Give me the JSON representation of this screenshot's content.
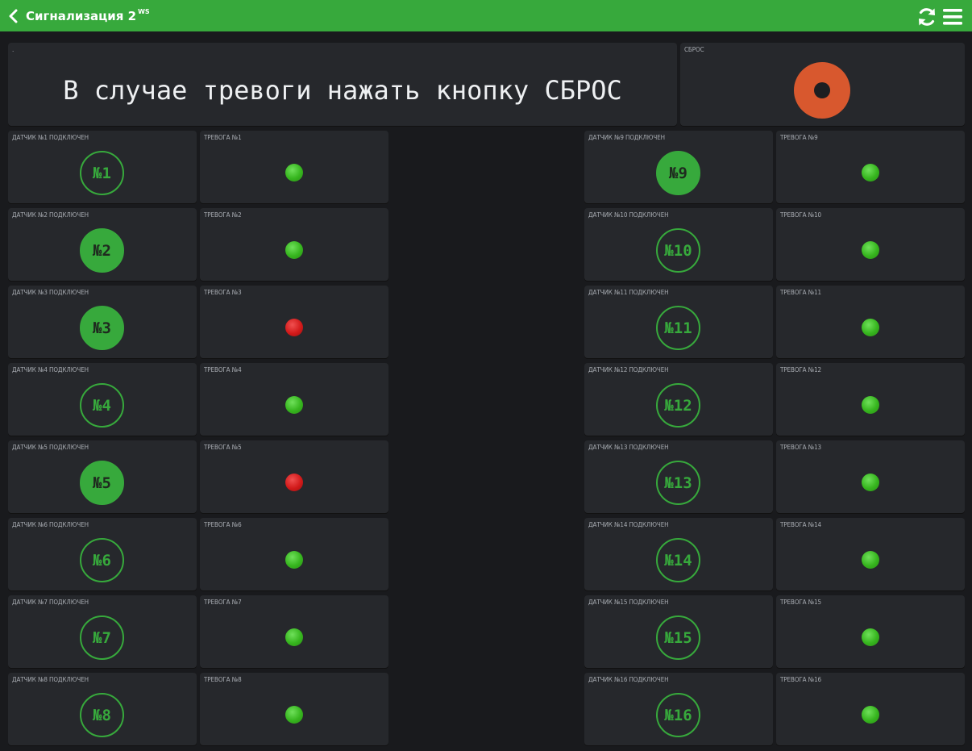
{
  "header": {
    "title": "Сигнализация 2",
    "superscript": "WS",
    "back_icon": "chevron-left-icon",
    "refresh_icon": "refresh-icon",
    "menu_icon": "menu-icon",
    "color": "#37a93c"
  },
  "message_tile": {
    "label": ".",
    "text": "В случае тревоги нажать кнопку СБРОС"
  },
  "reset_tile": {
    "label": "СБРОС",
    "color": "#d8582e"
  },
  "sensors": [
    {
      "label": "ДАТЧИК №1 ПОДКЛЮЧЕН",
      "number": "№1",
      "connected": false,
      "alarm_label": "ТРЕВОГА №1",
      "alarm": false
    },
    {
      "label": "ДАТЧИК №2 ПОДКЛЮЧЕН",
      "number": "№2",
      "connected": true,
      "alarm_label": "ТРЕВОГА №2",
      "alarm": false
    },
    {
      "label": "ДАТЧИК №3 ПОДКЛЮЧЕН",
      "number": "№3",
      "connected": true,
      "alarm_label": "ТРЕВОГА №3",
      "alarm": true
    },
    {
      "label": "ДАТЧИК №4 ПОДКЛЮЧЕН",
      "number": "№4",
      "connected": false,
      "alarm_label": "ТРЕВОГА №4",
      "alarm": false
    },
    {
      "label": "ДАТЧИК №5 ПОДКЛЮЧЕН",
      "number": "№5",
      "connected": true,
      "alarm_label": "ТРЕВОГА №5",
      "alarm": true
    },
    {
      "label": "ДАТЧИК №6 ПОДКЛЮЧЕН",
      "number": "№6",
      "connected": false,
      "alarm_label": "ТРЕВОГА №6",
      "alarm": false
    },
    {
      "label": "ДАТЧИК №7 ПОДКЛЮЧЕН",
      "number": "№7",
      "connected": false,
      "alarm_label": "ТРЕВОГА №7",
      "alarm": false
    },
    {
      "label": "ДАТЧИК №8 ПОДКЛЮЧЕН",
      "number": "№8",
      "connected": false,
      "alarm_label": "ТРЕВОГА №8",
      "alarm": false
    },
    {
      "label": "ДАТЧИК №9 ПОДКЛЮЧЕН",
      "number": "№9",
      "connected": true,
      "alarm_label": "ТРЕВОГА №9",
      "alarm": false
    },
    {
      "label": "ДАТЧИК №10 ПОДКЛЮЧЕН",
      "number": "№10",
      "connected": false,
      "alarm_label": "ТРЕВОГА №10",
      "alarm": false
    },
    {
      "label": "ДАТЧИК №11 ПОДКЛЮЧЕН",
      "number": "№11",
      "connected": false,
      "alarm_label": "ТРЕВОГА №11",
      "alarm": false
    },
    {
      "label": "ДАТЧИК №12 ПОДКЛЮЧЕН",
      "number": "№12",
      "connected": false,
      "alarm_label": "ТРЕВОГА №12",
      "alarm": false
    },
    {
      "label": "ДАТЧИК №13 ПОДКЛЮЧЕН",
      "number": "№13",
      "connected": false,
      "alarm_label": "ТРЕВОГА №13",
      "alarm": false
    },
    {
      "label": "ДАТЧИК №14 ПОДКЛЮЧЕН",
      "number": "№14",
      "connected": false,
      "alarm_label": "ТРЕВОГА №14",
      "alarm": false
    },
    {
      "label": "ДАТЧИК №15 ПОДКЛЮЧЕН",
      "number": "№15",
      "connected": false,
      "alarm_label": "ТРЕВОГА №15",
      "alarm": false
    },
    {
      "label": "ДАТЧИК №16 ПОДКЛЮЧЕН",
      "number": "№16",
      "connected": false,
      "alarm_label": "ТРЕВОГА №16",
      "alarm": false
    }
  ],
  "colors": {
    "sensor_accent": "#37a93c",
    "alarm_ok": "#36b51e",
    "alarm_active": "#d21a1a"
  }
}
